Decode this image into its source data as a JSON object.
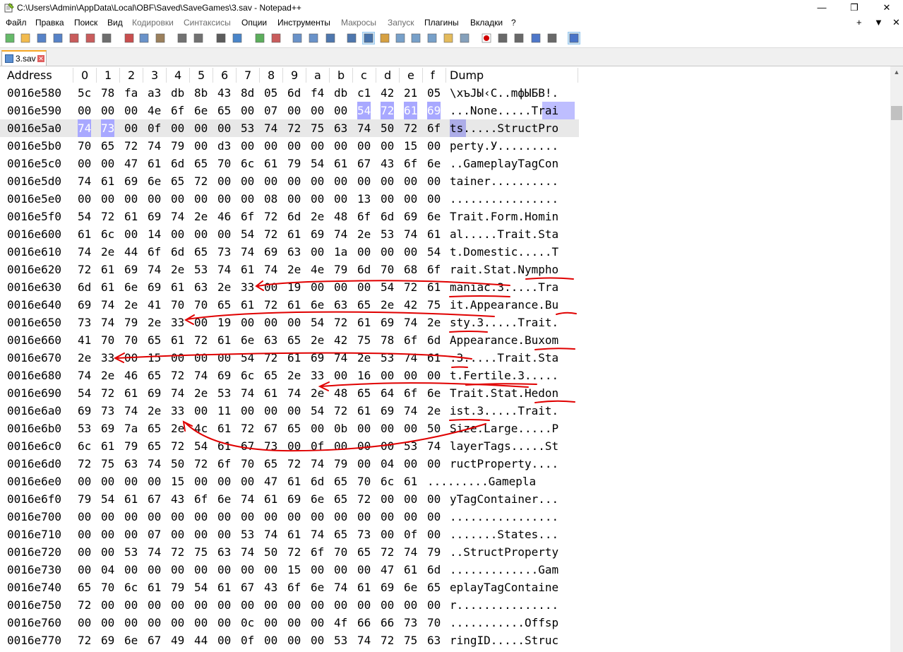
{
  "window": {
    "title": "C:\\Users\\Admin\\AppData\\Local\\OBF\\Saved\\SaveGames\\3.sav - Notepad++",
    "minimize_glyph": "—",
    "restore_glyph": "❐",
    "close_glyph": "✕"
  },
  "menu": {
    "items": [
      {
        "label": "Файл",
        "disabled": false
      },
      {
        "label": "Правка",
        "disabled": false
      },
      {
        "label": "Поиск",
        "disabled": false
      },
      {
        "label": "Вид",
        "disabled": false
      },
      {
        "label": "Кодировки",
        "disabled": true
      },
      {
        "label": "Синтаксисы",
        "disabled": true
      },
      {
        "label": "Опции",
        "disabled": false
      },
      {
        "label": "Инструменты",
        "disabled": false
      },
      {
        "label": "Макросы",
        "disabled": true
      },
      {
        "label": "Запуск",
        "disabled": true
      },
      {
        "label": "Плагины",
        "disabled": false
      },
      {
        "label": "Вкладки",
        "disabled": false
      },
      {
        "label": "?",
        "disabled": false
      }
    ],
    "right": [
      "+",
      "▼",
      "✕"
    ]
  },
  "toolbar": {
    "icons": [
      "new-file-icon",
      "open-file-icon",
      "save-icon",
      "save-all-icon",
      "close-icon",
      "close-all-icon",
      "print-icon",
      "cut-icon",
      "copy-icon",
      "paste-icon",
      "undo-icon",
      "redo-icon",
      "find-icon",
      "replace-icon",
      "zoom-in-icon",
      "zoom-out-icon",
      "sync-v-icon",
      "sync-h-icon",
      "word-wrap-icon",
      "all-chars-icon",
      "hex-view-icon",
      "indent-guide-icon",
      "lang-icon",
      "doc-map-icon",
      "func-list-icon",
      "folder-workspace-icon",
      "monitor-icon",
      "record-macro-icon",
      "stop-macro-icon",
      "play-macro-icon",
      "run-macro-multiple-icon",
      "save-macro-icon",
      "hex-editor-icon"
    ]
  },
  "tab": {
    "label": "3.sav",
    "close": "✕"
  },
  "hex": {
    "headers": [
      "Address",
      "0",
      "1",
      "2",
      "3",
      "4",
      "5",
      "6",
      "7",
      "8",
      "9",
      "a",
      "b",
      "c",
      "d",
      "e",
      "f",
      "Dump"
    ],
    "rows": [
      {
        "addr": "0016e580",
        "bytes": [
          "5c",
          "78",
          "fa",
          "a3",
          "db",
          "8b",
          "43",
          "8d",
          "05",
          "6d",
          "f4",
          "db",
          "c1",
          "42",
          "21",
          "05"
        ],
        "dump": "\\xъЈЫ‹C..mфЫБВ!."
      },
      {
        "addr": "0016e590",
        "bytes": [
          "00",
          "00",
          "00",
          "4e",
          "6f",
          "6e",
          "65",
          "00",
          "07",
          "00",
          "00",
          "00",
          "54",
          "72",
          "61",
          "69"
        ],
        "dump": "...None.....Trai"
      },
      {
        "addr": "0016e5a0",
        "bytes": [
          "74",
          "73",
          "00",
          "0f",
          "00",
          "00",
          "00",
          "53",
          "74",
          "72",
          "75",
          "63",
          "74",
          "50",
          "72",
          "6f"
        ],
        "dump": "ts.....StructPro"
      },
      {
        "addr": "0016e5b0",
        "bytes": [
          "70",
          "65",
          "72",
          "74",
          "79",
          "00",
          "d3",
          "00",
          "00",
          "00",
          "00",
          "00",
          "00",
          "00",
          "15",
          "00"
        ],
        "dump": "perty.У........."
      },
      {
        "addr": "0016e5c0",
        "bytes": [
          "00",
          "00",
          "47",
          "61",
          "6d",
          "65",
          "70",
          "6c",
          "61",
          "79",
          "54",
          "61",
          "67",
          "43",
          "6f",
          "6e"
        ],
        "dump": "..GameplayTagCon"
      },
      {
        "addr": "0016e5d0",
        "bytes": [
          "74",
          "61",
          "69",
          "6e",
          "65",
          "72",
          "00",
          "00",
          "00",
          "00",
          "00",
          "00",
          "00",
          "00",
          "00",
          "00"
        ],
        "dump": "tainer.........."
      },
      {
        "addr": "0016e5e0",
        "bytes": [
          "00",
          "00",
          "00",
          "00",
          "00",
          "00",
          "00",
          "00",
          "08",
          "00",
          "00",
          "00",
          "13",
          "00",
          "00",
          "00"
        ],
        "dump": "................"
      },
      {
        "addr": "0016e5f0",
        "bytes": [
          "54",
          "72",
          "61",
          "69",
          "74",
          "2e",
          "46",
          "6f",
          "72",
          "6d",
          "2e",
          "48",
          "6f",
          "6d",
          "69",
          "6e"
        ],
        "dump": "Trait.Form.Homin"
      },
      {
        "addr": "0016e600",
        "bytes": [
          "61",
          "6c",
          "00",
          "14",
          "00",
          "00",
          "00",
          "54",
          "72",
          "61",
          "69",
          "74",
          "2e",
          "53",
          "74",
          "61"
        ],
        "dump": "al.....Trait.Sta"
      },
      {
        "addr": "0016e610",
        "bytes": [
          "74",
          "2e",
          "44",
          "6f",
          "6d",
          "65",
          "73",
          "74",
          "69",
          "63",
          "00",
          "1a",
          "00",
          "00",
          "00",
          "54"
        ],
        "dump": "t.Domestic.....T"
      },
      {
        "addr": "0016e620",
        "bytes": [
          "72",
          "61",
          "69",
          "74",
          "2e",
          "53",
          "74",
          "61",
          "74",
          "2e",
          "4e",
          "79",
          "6d",
          "70",
          "68",
          "6f"
        ],
        "dump": "rait.Stat.Nympho"
      },
      {
        "addr": "0016e630",
        "bytes": [
          "6d",
          "61",
          "6e",
          "69",
          "61",
          "63",
          "2e",
          "33",
          "00",
          "19",
          "00",
          "00",
          "00",
          "54",
          "72",
          "61"
        ],
        "dump": "maniac.3.....Tra"
      },
      {
        "addr": "0016e640",
        "bytes": [
          "69",
          "74",
          "2e",
          "41",
          "70",
          "70",
          "65",
          "61",
          "72",
          "61",
          "6e",
          "63",
          "65",
          "2e",
          "42",
          "75"
        ],
        "dump": "it.Appearance.Bu"
      },
      {
        "addr": "0016e650",
        "bytes": [
          "73",
          "74",
          "79",
          "2e",
          "33",
          "00",
          "19",
          "00",
          "00",
          "00",
          "54",
          "72",
          "61",
          "69",
          "74",
          "2e"
        ],
        "dump": "sty.3.....Trait."
      },
      {
        "addr": "0016e660",
        "bytes": [
          "41",
          "70",
          "70",
          "65",
          "61",
          "72",
          "61",
          "6e",
          "63",
          "65",
          "2e",
          "42",
          "75",
          "78",
          "6f",
          "6d"
        ],
        "dump": "Appearance.Buxom"
      },
      {
        "addr": "0016e670",
        "bytes": [
          "2e",
          "33",
          "00",
          "15",
          "00",
          "00",
          "00",
          "54",
          "72",
          "61",
          "69",
          "74",
          "2e",
          "53",
          "74",
          "61"
        ],
        "dump": ".3.....Trait.Sta"
      },
      {
        "addr": "0016e680",
        "bytes": [
          "74",
          "2e",
          "46",
          "65",
          "72",
          "74",
          "69",
          "6c",
          "65",
          "2e",
          "33",
          "00",
          "16",
          "00",
          "00",
          "00"
        ],
        "dump": "t.Fertile.3....."
      },
      {
        "addr": "0016e690",
        "bytes": [
          "54",
          "72",
          "61",
          "69",
          "74",
          "2e",
          "53",
          "74",
          "61",
          "74",
          "2e",
          "48",
          "65",
          "64",
          "6f",
          "6e"
        ],
        "dump": "Trait.Stat.Hedon"
      },
      {
        "addr": "0016e6a0",
        "bytes": [
          "69",
          "73",
          "74",
          "2e",
          "33",
          "00",
          "11",
          "00",
          "00",
          "00",
          "54",
          "72",
          "61",
          "69",
          "74",
          "2e"
        ],
        "dump": "ist.3.....Trait."
      },
      {
        "addr": "0016e6b0",
        "bytes": [
          "53",
          "69",
          "7a",
          "65",
          "2e",
          "4c",
          "61",
          "72",
          "67",
          "65",
          "00",
          "0b",
          "00",
          "00",
          "00",
          "50"
        ],
        "dump": "Size.Large.....P"
      },
      {
        "addr": "0016e6c0",
        "bytes": [
          "6c",
          "61",
          "79",
          "65",
          "72",
          "54",
          "61",
          "67",
          "73",
          "00",
          "0f",
          "00",
          "00",
          "00",
          "53",
          "74"
        ],
        "dump": "layerTags.....St"
      },
      {
        "addr": "0016e6d0",
        "bytes": [
          "72",
          "75",
          "63",
          "74",
          "50",
          "72",
          "6f",
          "70",
          "65",
          "72",
          "74",
          "79",
          "00",
          "04",
          "00",
          "00"
        ],
        "dump": "ructProperty...."
      },
      {
        "addr": "0016e6e0",
        "bytes": [
          "00",
          "00",
          "00",
          "00",
          "15",
          "00",
          "00",
          "00",
          "47",
          "61",
          "6d",
          "65",
          "70",
          "6c",
          "61"
        ],
        "dump": ".........Gamepla"
      },
      {
        "addr": "0016e6f0",
        "bytes": [
          "79",
          "54",
          "61",
          "67",
          "43",
          "6f",
          "6e",
          "74",
          "61",
          "69",
          "6e",
          "65",
          "72",
          "00",
          "00",
          "00"
        ],
        "dump": "yTagContainer..."
      },
      {
        "addr": "0016e700",
        "bytes": [
          "00",
          "00",
          "00",
          "00",
          "00",
          "00",
          "00",
          "00",
          "00",
          "00",
          "00",
          "00",
          "00",
          "00",
          "00",
          "00"
        ],
        "dump": "................"
      },
      {
        "addr": "0016e710",
        "bytes": [
          "00",
          "00",
          "00",
          "07",
          "00",
          "00",
          "00",
          "53",
          "74",
          "61",
          "74",
          "65",
          "73",
          "00",
          "0f",
          "00"
        ],
        "dump": ".......States..."
      },
      {
        "addr": "0016e720",
        "bytes": [
          "00",
          "00",
          "53",
          "74",
          "72",
          "75",
          "63",
          "74",
          "50",
          "72",
          "6f",
          "70",
          "65",
          "72",
          "74",
          "79"
        ],
        "dump": "..StructProperty"
      },
      {
        "addr": "0016e730",
        "bytes": [
          "00",
          "04",
          "00",
          "00",
          "00",
          "00",
          "00",
          "00",
          "00",
          "15",
          "00",
          "00",
          "00",
          "47",
          "61",
          "6d"
        ],
        "dump": ".............Gam"
      },
      {
        "addr": "0016e740",
        "bytes": [
          "65",
          "70",
          "6c",
          "61",
          "79",
          "54",
          "61",
          "67",
          "43",
          "6f",
          "6e",
          "74",
          "61",
          "69",
          "6e",
          "65"
        ],
        "dump": "eplayTagContaine"
      },
      {
        "addr": "0016e750",
        "bytes": [
          "72",
          "00",
          "00",
          "00",
          "00",
          "00",
          "00",
          "00",
          "00",
          "00",
          "00",
          "00",
          "00",
          "00",
          "00",
          "00"
        ],
        "dump": "r..............."
      },
      {
        "addr": "0016e760",
        "bytes": [
          "00",
          "00",
          "00",
          "00",
          "00",
          "00",
          "00",
          "0c",
          "00",
          "00",
          "00",
          "4f",
          "66",
          "66",
          "73",
          "70"
        ],
        "dump": "...........Offsp"
      },
      {
        "addr": "0016e770",
        "bytes": [
          "72",
          "69",
          "6e",
          "67",
          "49",
          "44",
          "00",
          "0f",
          "00",
          "00",
          "00",
          "53",
          "74",
          "72",
          "75",
          "63"
        ],
        "dump": "ringID.....Struc"
      }
    ],
    "selection_color": "#a8a8ff",
    "current_line_color": "#e8e8e8",
    "annotation_color": "#e00000"
  }
}
